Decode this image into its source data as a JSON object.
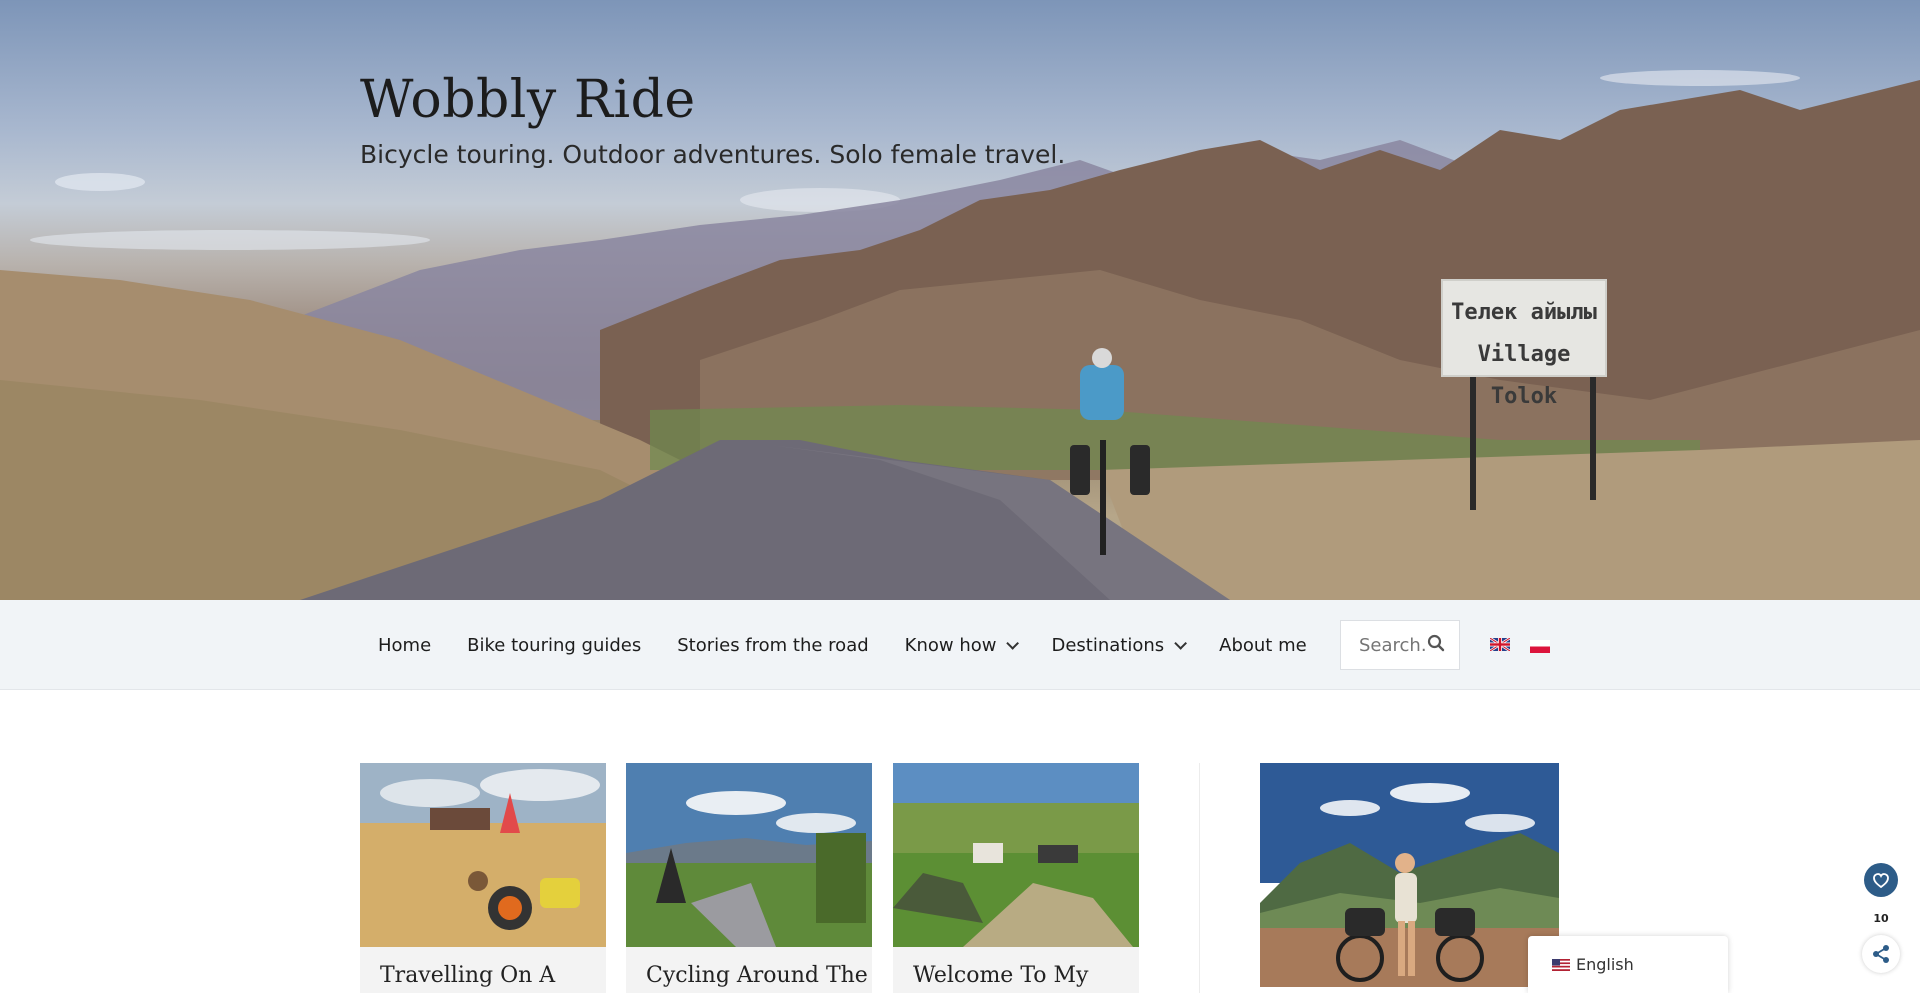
{
  "site": {
    "title": "Wobbly Ride",
    "tagline": "Bicycle touring. Outdoor adventures. Solo female travel."
  },
  "hero": {
    "sign_line1": "Телек айылы",
    "sign_line2": "Village Tolok"
  },
  "nav": {
    "items": [
      {
        "label": "Home",
        "has_dropdown": false
      },
      {
        "label": "Bike touring guides",
        "has_dropdown": false
      },
      {
        "label": "Stories from the road",
        "has_dropdown": false
      },
      {
        "label": "Know how",
        "has_dropdown": true
      },
      {
        "label": "Destinations",
        "has_dropdown": true
      },
      {
        "label": "About me",
        "has_dropdown": false
      }
    ],
    "search_placeholder": "Search..."
  },
  "cards": [
    {
      "title": "Travelling On A"
    },
    {
      "title": "Cycling Around The"
    },
    {
      "title": "Welcome To My"
    }
  ],
  "language_switcher": {
    "label": "English"
  },
  "widgets": {
    "like_count": "10"
  },
  "colors": {
    "nav_background": "#f1f4f7",
    "heart_button": "#2d5c88",
    "card_background": "#f3f3f3"
  }
}
